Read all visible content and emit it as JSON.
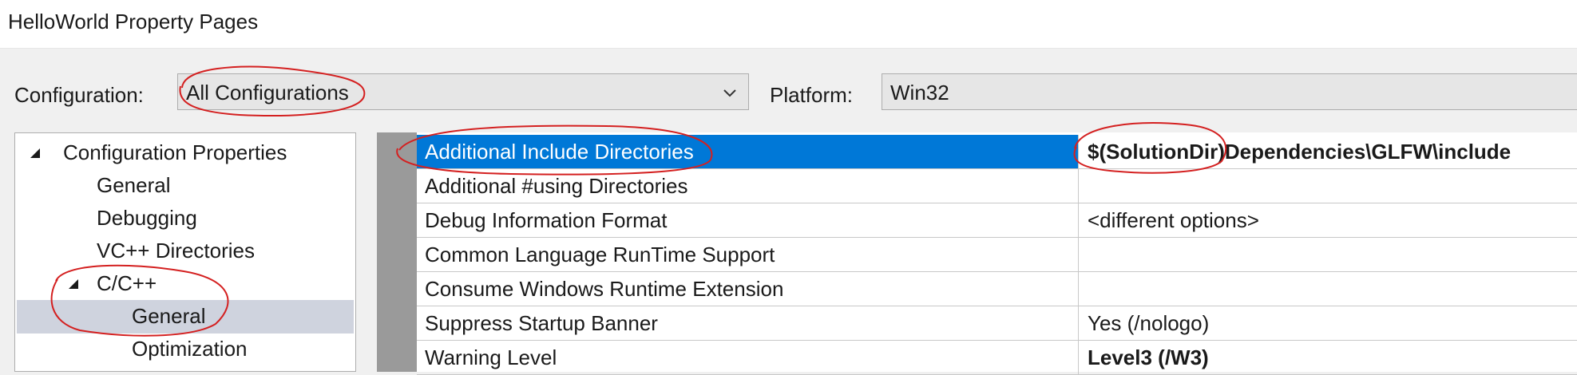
{
  "window": {
    "title": "HelloWorld Property Pages"
  },
  "toolbar": {
    "configuration_label": "Configuration:",
    "configuration_value": "All Configurations",
    "platform_label": "Platform:",
    "platform_value": "Win32"
  },
  "tree": {
    "items": [
      {
        "label": "Configuration Properties",
        "expanded": true
      },
      {
        "label": "General"
      },
      {
        "label": "Debugging"
      },
      {
        "label": "VC++ Directories"
      },
      {
        "label": "C/C++",
        "expanded": true
      },
      {
        "label": "General",
        "selected": true
      },
      {
        "label": "Optimization"
      }
    ]
  },
  "grid": {
    "rows": [
      {
        "name": "Additional Include Directories",
        "value": "$(SolutionDir)Dependencies\\GLFW\\include",
        "selected": true,
        "bold": true
      },
      {
        "name": "Additional #using Directories",
        "value": ""
      },
      {
        "name": "Debug Information Format",
        "value": "<different options>"
      },
      {
        "name": "Common Language RunTime Support",
        "value": ""
      },
      {
        "name": "Consume Windows Runtime Extension",
        "value": ""
      },
      {
        "name": "Suppress Startup Banner",
        "value": "Yes (/nologo)"
      },
      {
        "name": "Warning Level",
        "value": "Level3 (/W3)",
        "bold": true
      }
    ]
  },
  "colors": {
    "selection": "#0078d7",
    "tree_selection": "#cfd3de",
    "annotation": "#d42020"
  }
}
